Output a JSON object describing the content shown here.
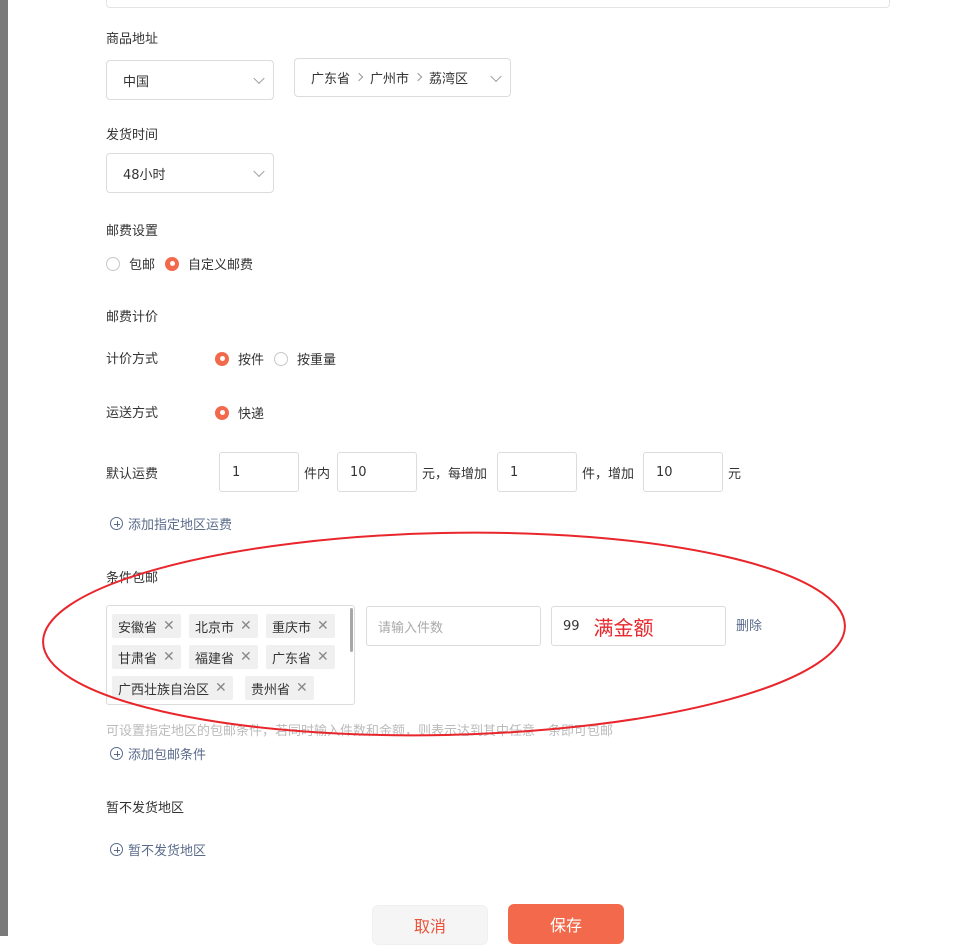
{
  "address": {
    "label": "商品地址",
    "country": "中国",
    "province": "广东省",
    "city": "广州市",
    "district": "荔湾区"
  },
  "delivery_time": {
    "label": "发货时间",
    "value": "48小时"
  },
  "postage_setting": {
    "label": "邮费设置",
    "options": [
      "包邮",
      "自定义邮费"
    ],
    "selected": "自定义邮费"
  },
  "postage_pricing": {
    "label": "邮费计价",
    "method_label": "计价方式",
    "methods": [
      "按件",
      "按重量"
    ],
    "method_selected": "按件",
    "shipping_label": "运送方式",
    "shipping_options": [
      "快递"
    ],
    "shipping_selected": "快递"
  },
  "default_fee": {
    "label": "默认运费",
    "first_count": "1",
    "unit_within": "件内",
    "first_fee": "10",
    "unit_each_add": "元，每增加",
    "add_count": "1",
    "unit_add": "件，增加",
    "add_fee": "10",
    "unit_yuan": "元"
  },
  "add_region_fee_link": "添加指定地区运费",
  "conditional_free": {
    "label": "条件包邮",
    "regions": [
      "安徽省",
      "北京市",
      "重庆市",
      "甘肃省",
      "福建省",
      "广东省",
      "广西壮族自治区",
      "贵州省"
    ],
    "count_placeholder": "请输入件数",
    "amount_value": "99",
    "annotation": "满金额",
    "delete_label": "删除",
    "hint": "可设置指定地区的包邮条件，若同时输入件数和金额，则表示达到其中任意一条即可包邮",
    "add_condition_link": "添加包邮条件"
  },
  "no_delivery": {
    "label": "暂不发货地区",
    "add_link": "暂不发货地区"
  },
  "buttons": {
    "cancel": "取消",
    "save": "保存"
  },
  "colors": {
    "accent": "#f26a4b",
    "link": "#5a6b8a",
    "annotation": "#e8262b"
  }
}
